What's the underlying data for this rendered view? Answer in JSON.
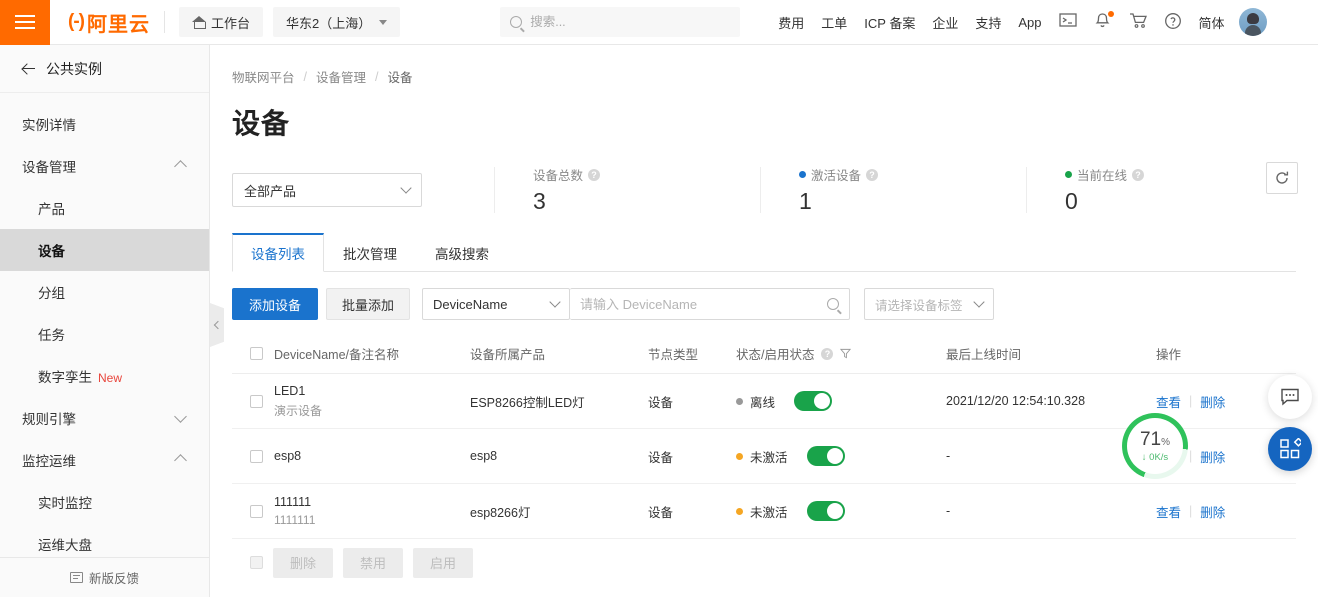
{
  "header": {
    "logo_mark": "(-)",
    "logo_text": "阿里云",
    "workbench": "工作台",
    "region": "华东2（上海）",
    "search_placeholder": "搜索...",
    "search_value": "",
    "nav": [
      {
        "label": "费用"
      },
      {
        "label": "工单"
      },
      {
        "label": "ICP 备案"
      },
      {
        "label": "企业"
      },
      {
        "label": "支持"
      },
      {
        "label": "App"
      }
    ],
    "icons": [
      "terminal-icon",
      "bell-icon",
      "cart-icon",
      "help-icon"
    ],
    "language": "简体"
  },
  "sidebar": {
    "back_label": "公共实例",
    "items": [
      {
        "label": "实例详情",
        "type": "item"
      },
      {
        "label": "设备管理",
        "type": "group",
        "expanded": true
      },
      {
        "label": "产品",
        "type": "sub"
      },
      {
        "label": "设备",
        "type": "sub",
        "active": true
      },
      {
        "label": "分组",
        "type": "sub"
      },
      {
        "label": "任务",
        "type": "sub"
      },
      {
        "label": "数字孪生",
        "type": "sub",
        "tag": "New"
      },
      {
        "label": "规则引擎",
        "type": "group",
        "expanded": false
      },
      {
        "label": "监控运维",
        "type": "group",
        "expanded": true
      },
      {
        "label": "实时监控",
        "type": "sub"
      },
      {
        "label": "运维大盘",
        "type": "sub"
      }
    ],
    "footer_label": "新版反馈"
  },
  "main": {
    "breadcrumb": [
      "物联网平台",
      "设备管理",
      "设备"
    ],
    "page_title": "设备",
    "product_filter": "全部产品",
    "stats": [
      {
        "label": "设备总数",
        "value": "3",
        "dot": "none"
      },
      {
        "label": "激活设备",
        "value": "1",
        "dot": "#1a73cd"
      },
      {
        "label": "当前在线",
        "value": "0",
        "dot": "#19a34a"
      }
    ],
    "refresh_icon": "refresh-icon",
    "tabs": [
      {
        "label": "设备列表",
        "active": true
      },
      {
        "label": "批次管理",
        "active": false
      },
      {
        "label": "高级搜索",
        "active": false
      }
    ],
    "toolbar": {
      "add_device": "添加设备",
      "batch_add": "批量添加",
      "search_field": "DeviceName",
      "search_placeholder": "请输入 DeviceName",
      "search_value": "",
      "tag_select": "请选择设备标签"
    },
    "table": {
      "columns": [
        "DeviceName/备注名称",
        "设备所属产品",
        "节点类型",
        "状态/启用状态",
        "最后上线时间",
        "操作"
      ],
      "rows": [
        {
          "name": "LED1",
          "note": "演示设备",
          "product": "ESP8266控制LED灯",
          "node_type": "设备",
          "state": "离线",
          "state_color": "#999999",
          "enabled": true,
          "last_online": "2021/12/20 12:54:10.328",
          "ops": [
            "查看",
            "删除"
          ]
        },
        {
          "name": "esp8",
          "note": "",
          "product": "esp8",
          "node_type": "设备",
          "state": "未激活",
          "state_color": "#f5a623",
          "enabled": true,
          "last_online": "-",
          "ops": [
            "查看",
            "删除"
          ]
        },
        {
          "name": "111111",
          "note": "1111111",
          "product": "esp8266灯",
          "node_type": "设备",
          "state": "未激活",
          "state_color": "#f5a623",
          "enabled": true,
          "last_online": "-",
          "ops": [
            "查看",
            "删除"
          ]
        }
      ]
    },
    "bulk_actions": [
      {
        "label": "删除",
        "disabled": true
      },
      {
        "label": "禁用",
        "disabled": true
      },
      {
        "label": "启用",
        "disabled": true
      }
    ]
  },
  "overlays": {
    "network_widget": {
      "percent": "71",
      "percent_unit": "%",
      "speed": "0K/s",
      "speed_arrow": "↓",
      "ring_color": "#2fc25b"
    },
    "chat_fab": "chat-icon",
    "grid_fab": "apps-grid-icon"
  }
}
